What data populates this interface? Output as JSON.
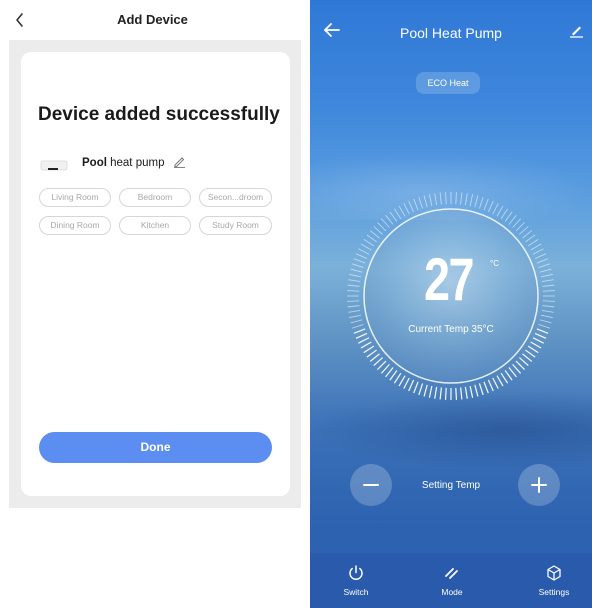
{
  "left": {
    "header": {
      "title": "Add Device"
    },
    "success_title": "Device added successfully",
    "device": {
      "name_bold": "Pool",
      "name_rest": " heat pump"
    },
    "rooms": [
      "Living Room",
      "Bedroom",
      "Secon...droom",
      "Dining Room",
      "Kitchen",
      "Study Room"
    ],
    "done_label": "Done"
  },
  "right": {
    "header": {
      "title": "Pool Heat Pump"
    },
    "mode": "ECO Heat",
    "set_temp": "27",
    "unit": "°C",
    "current_temp": "Current Temp 35°C",
    "setting_label": "Setting Temp",
    "tabs": [
      {
        "label": "Switch",
        "icon": "power-icon"
      },
      {
        "label": "Mode",
        "icon": "mode-icon"
      },
      {
        "label": "Settings",
        "icon": "settings-cube-icon"
      }
    ]
  },
  "colors": {
    "accent_blue": "#5b8ef0",
    "sky_blue": "#3f88dc"
  }
}
